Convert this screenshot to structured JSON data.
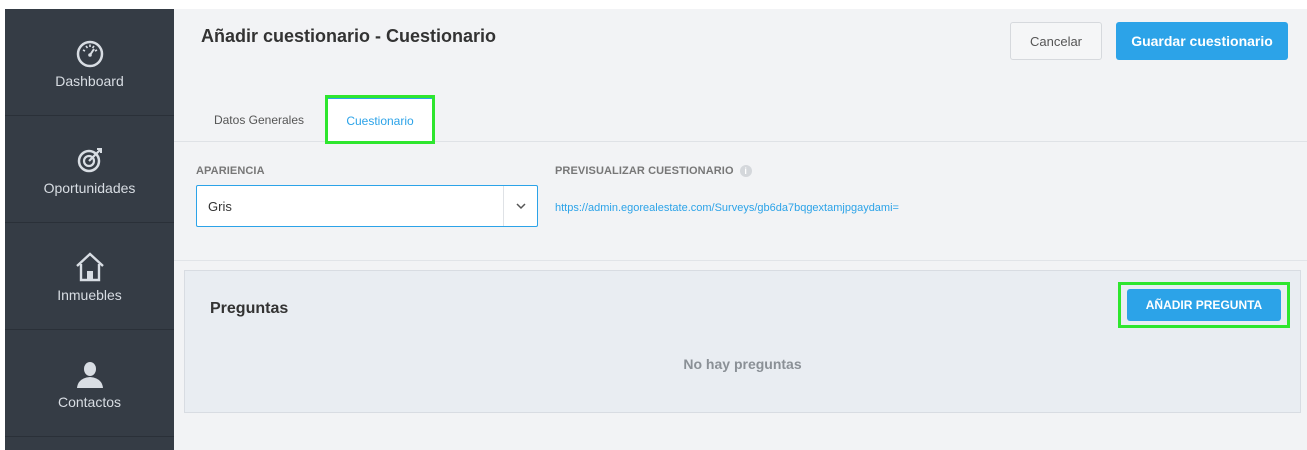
{
  "sidebar": {
    "items": [
      {
        "label": "Dashboard",
        "icon": "dashboard-gauge-icon"
      },
      {
        "label": "Oportunidades",
        "icon": "target-icon"
      },
      {
        "label": "Inmuebles",
        "icon": "home-icon"
      },
      {
        "label": "Contactos",
        "icon": "user-icon"
      }
    ]
  },
  "header": {
    "title": "Añadir cuestionario - Cuestionario",
    "cancel_label": "Cancelar",
    "save_label": "Guardar cuestionario"
  },
  "tabs": [
    {
      "label": "Datos Generales",
      "active": false
    },
    {
      "label": "Cuestionario",
      "active": true
    }
  ],
  "appearance": {
    "label": "APARIENCIA",
    "selected": "Gris"
  },
  "preview": {
    "label": "PREVISUALIZAR CUESTIONARIO",
    "url": "https://admin.egorealestate.com/Surveys/gb6da7bqgextamjpgaydami="
  },
  "questions": {
    "title": "Preguntas",
    "add_label": "AÑADIR PREGUNTA",
    "empty_message": "No hay preguntas"
  },
  "colors": {
    "accent": "#2ca3e8",
    "sidebar_bg": "#353c45",
    "highlight": "#2ee62e"
  }
}
